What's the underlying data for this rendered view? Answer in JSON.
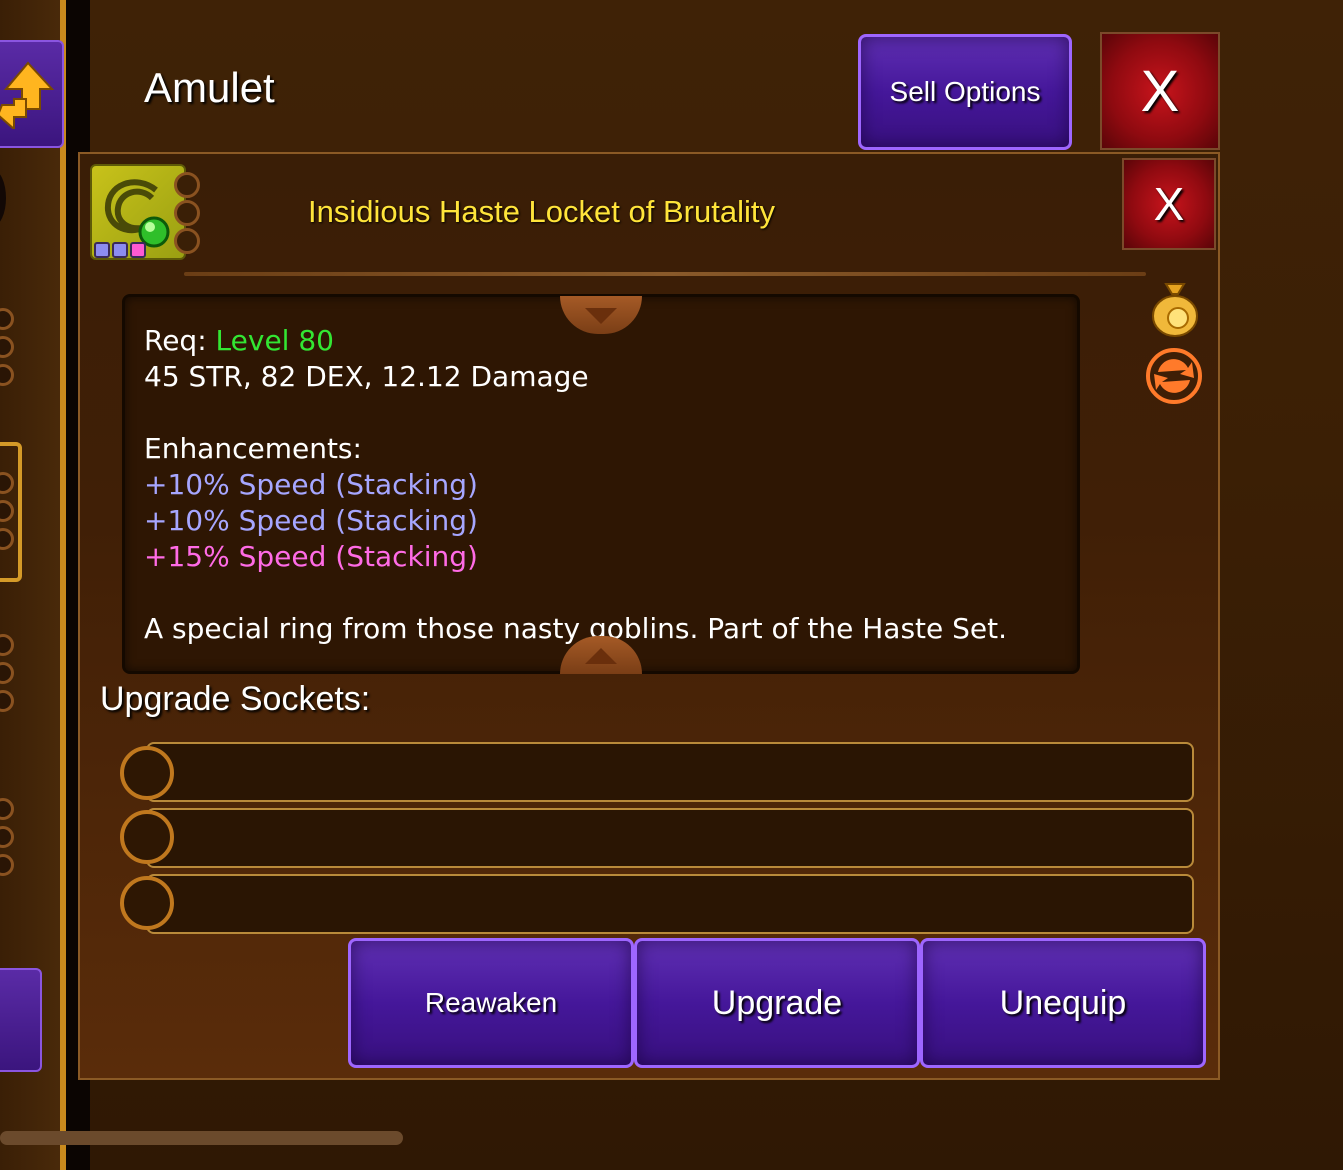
{
  "screen": {
    "title": "Amulet",
    "sell_options": "Sell Options",
    "close_label": "X"
  },
  "item": {
    "name": "Insidious Haste Locket of Brutality",
    "close_label": "X",
    "req_label": "Req:",
    "req_level": "Level 80",
    "stats": "45 STR, 82 DEX, 12.12 Damage",
    "enhancements_label": "Enhancements:",
    "enhancements": [
      {
        "text": "+10% Speed (Stacking)",
        "color": "#a6a6ff"
      },
      {
        "text": "+10% Speed (Stacking)",
        "color": "#a6a6ff"
      },
      {
        "text": "+15% Speed (Stacking)",
        "color": "#ff6be6"
      }
    ],
    "description": "A special ring from those nasty goblins. Part of the Haste Set.",
    "gem_colors": [
      "#8c8cf0",
      "#8c8cf0",
      "#ff5ad2"
    ]
  },
  "sockets": {
    "label": "Upgrade Sockets:",
    "slots": [
      "",
      "",
      ""
    ]
  },
  "actions": {
    "reawaken": "Reawaken",
    "upgrade": "Upgrade",
    "unequip": "Unequip"
  },
  "colors": {
    "panel_bg": "#3a1e06",
    "button_purple": "#45179a",
    "close_red": "#c8141c",
    "item_name": "#ffe43a",
    "req_level": "#33e633"
  }
}
